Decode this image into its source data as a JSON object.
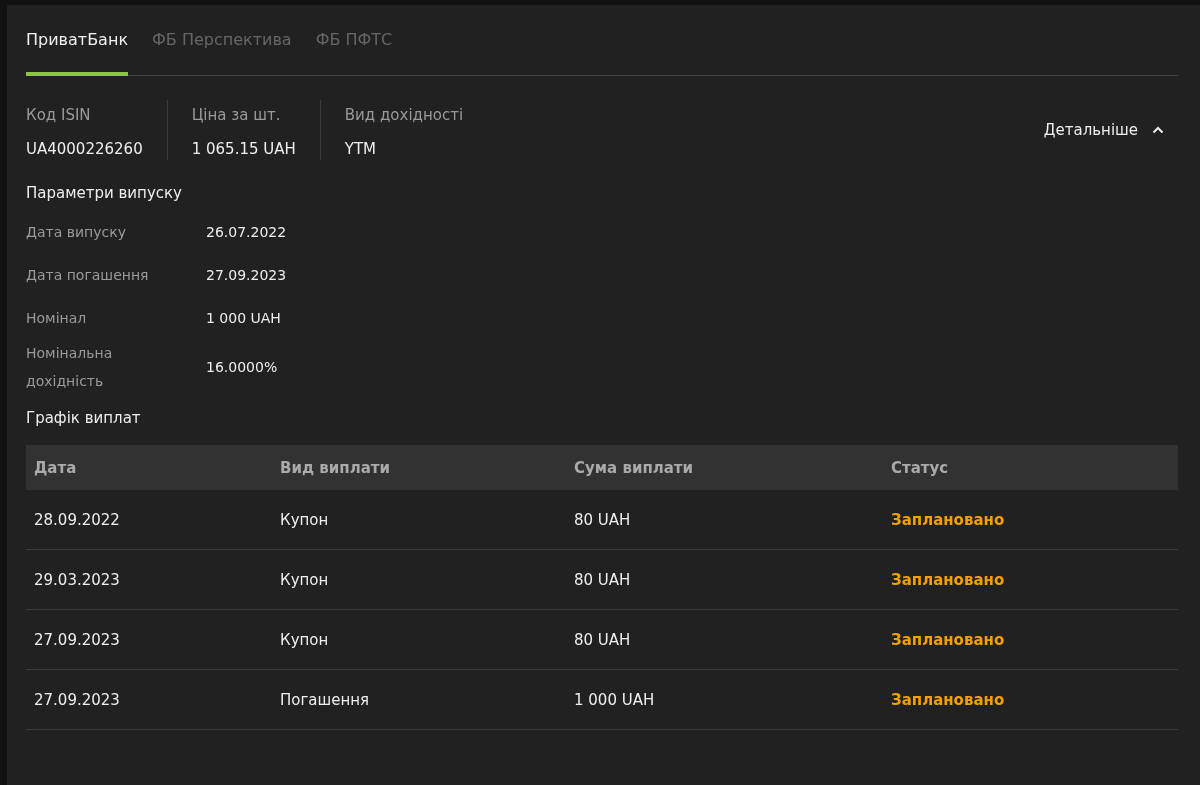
{
  "tabs": [
    {
      "label": "ПриватБанк",
      "selected": true
    },
    {
      "label": "ФБ Перспектива",
      "selected": false
    },
    {
      "label": "ФБ ПФТС",
      "selected": false
    }
  ],
  "summary": [
    {
      "label": "Код ISIN",
      "value": "UA4000226260"
    },
    {
      "label": "Ціна за шт.",
      "value": "1 065.15 UAH"
    },
    {
      "label": "Вид дохідності",
      "value": "YTM"
    }
  ],
  "details_toggle": {
    "label": "Детальніше",
    "expanded": true
  },
  "issue_params": {
    "title": "Параметри випуску",
    "rows": [
      {
        "label": "Дата випуску",
        "value": "26.07.2022"
      },
      {
        "label": "Дата погашення",
        "value": "27.09.2023"
      },
      {
        "label": "Номінал",
        "value": "1 000 UAH"
      },
      {
        "label": "Номінальна дохідність",
        "value": "16.0000%"
      }
    ]
  },
  "payments": {
    "title": "Графік виплат",
    "columns": [
      "Дата",
      "Вид виплати",
      "Сума виплати",
      "Статус"
    ],
    "rows": [
      {
        "date": "28.09.2022",
        "type": "Купон",
        "amount": "80 UAH",
        "status": "Заплановано",
        "color": "#f59f00"
      },
      {
        "date": "29.03.2023",
        "type": "Купон",
        "amount": "80 UAH",
        "status": "Заплановано",
        "color": "#f59f00"
      },
      {
        "date": "27.09.2023",
        "type": "Купон",
        "amount": "80 UAH",
        "status": "Заплановано",
        "color": "#f59f00"
      },
      {
        "date": "27.09.2023",
        "type": "Погашення",
        "amount": "1 000 UAH",
        "status": "Заплановано",
        "color": "#f59f00"
      }
    ]
  }
}
